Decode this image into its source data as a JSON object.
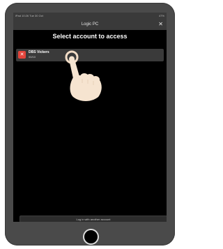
{
  "status": {
    "left": "iPad 10:26 Tue 30 Oct",
    "right": "47%"
  },
  "titlebar": {
    "title": "Logic PC",
    "close_symbol": "✕"
  },
  "heading": "Select account to access",
  "account": {
    "name": "DBS Vickers",
    "sub": "00/10",
    "icon_symbol": "✕",
    "icon_color": "#e2443b"
  },
  "login_button": "Log in with another account",
  "icons": [
    "close-icon",
    "account-error-icon",
    "pointing-hand-icon",
    "home-button-icon"
  ]
}
